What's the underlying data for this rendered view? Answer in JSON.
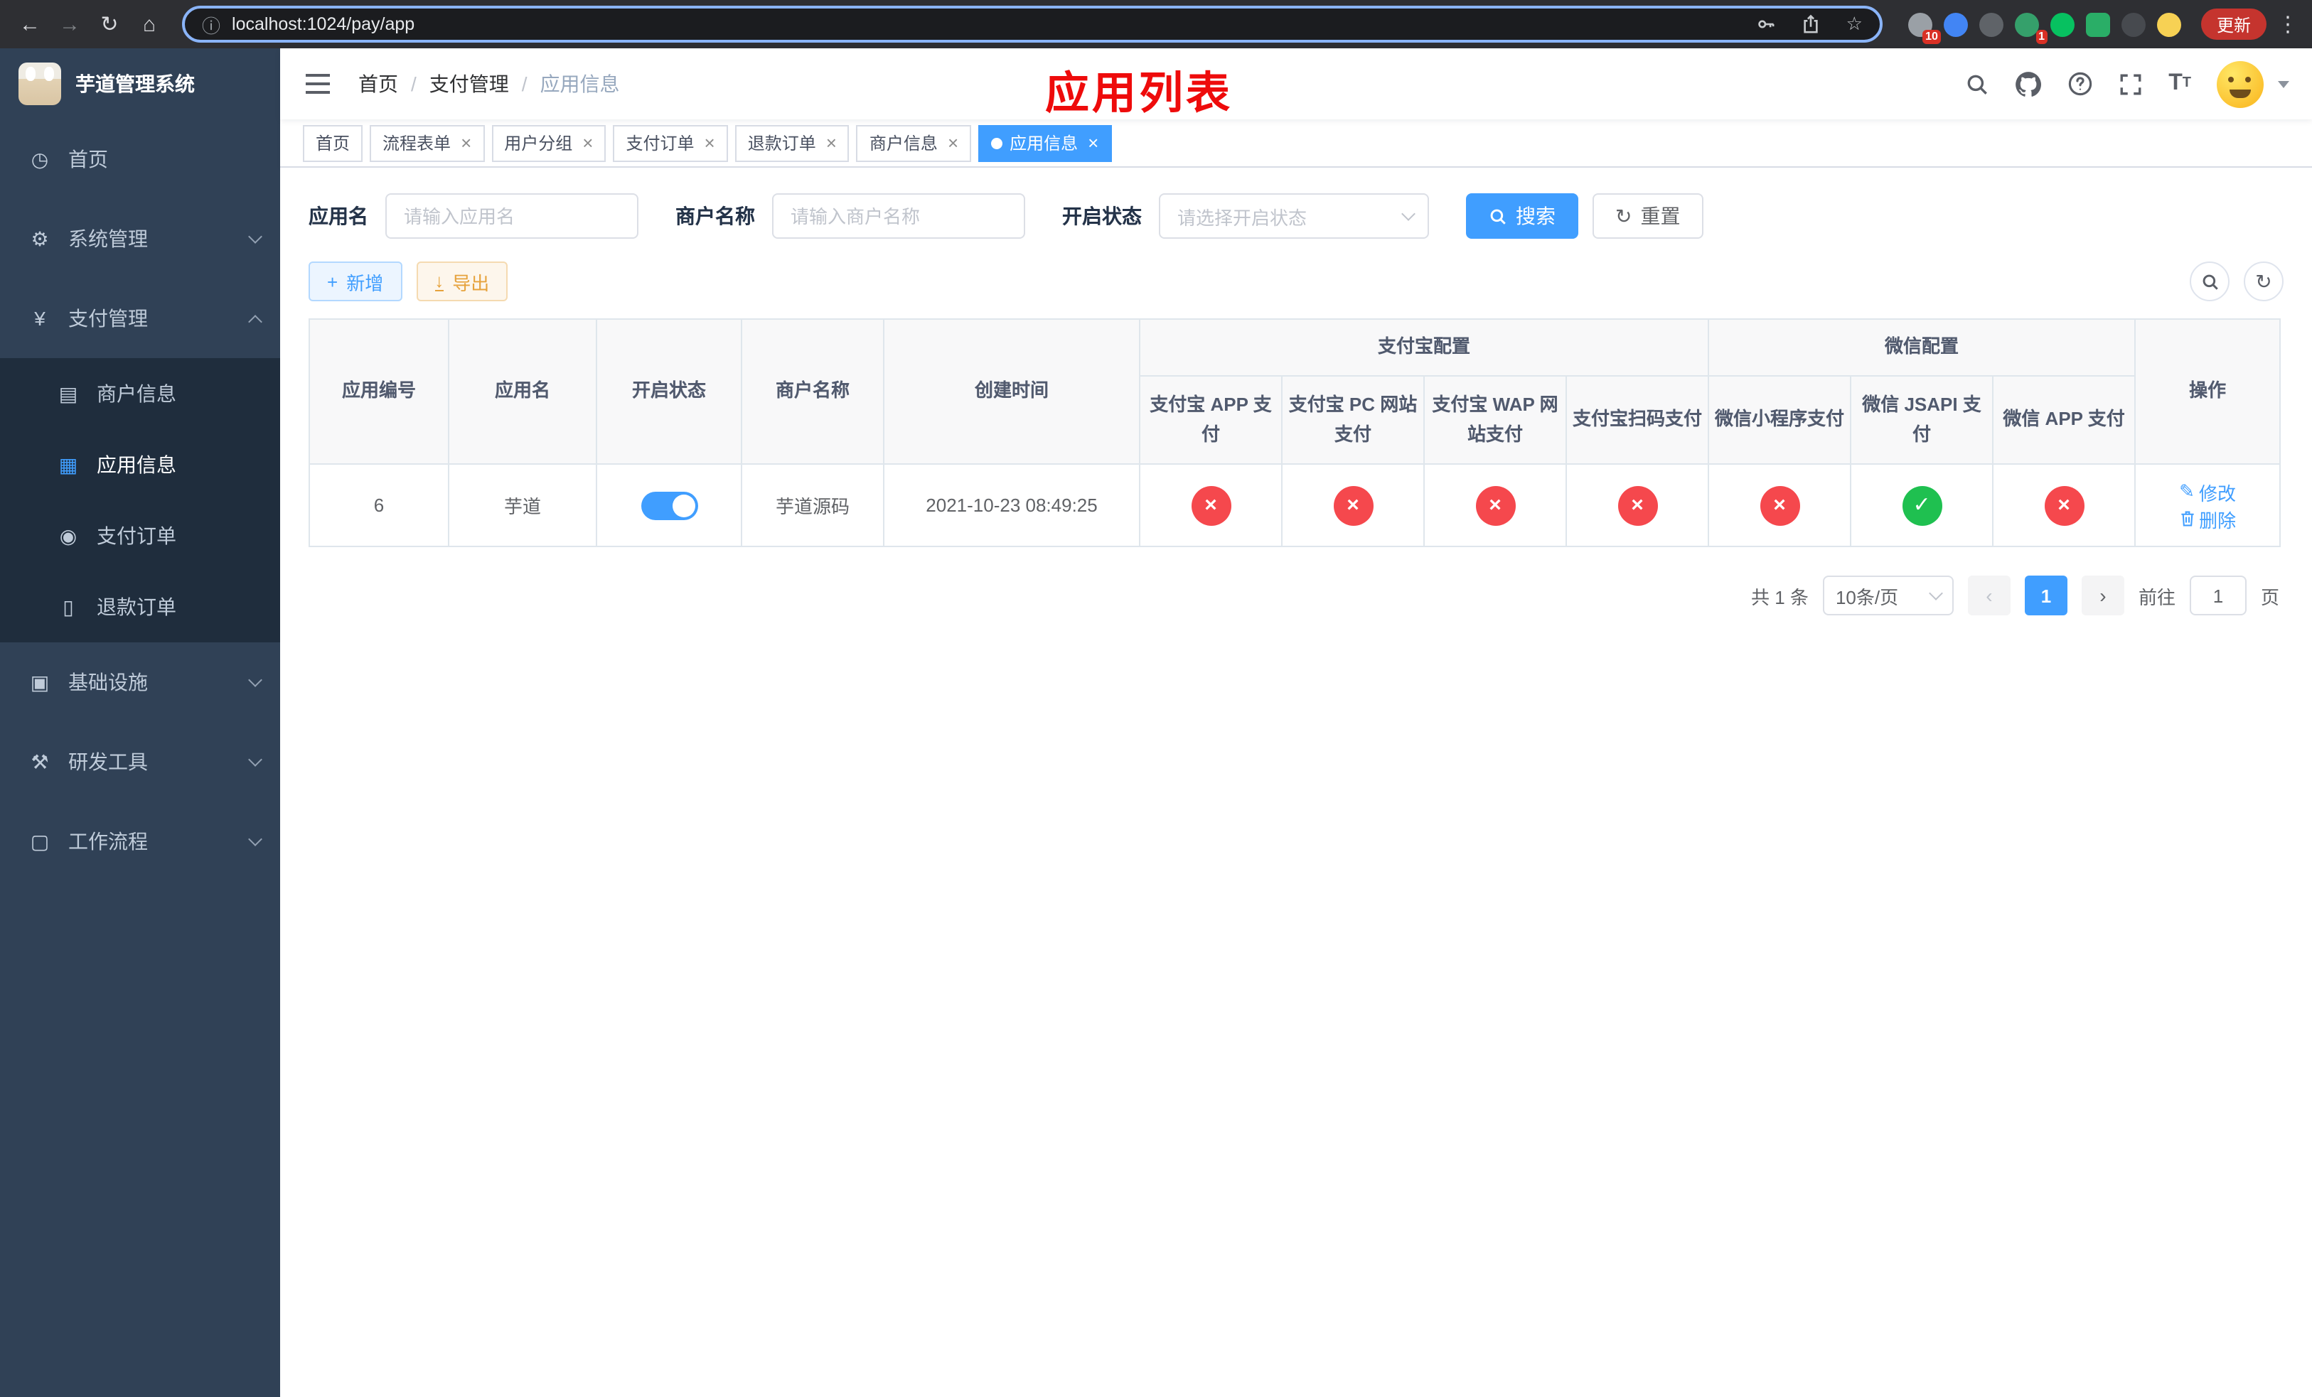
{
  "browser": {
    "url": "localhost:1024/pay/app",
    "update_label": "更新",
    "ext_badge_count": "10",
    "avatar_badge_count": "1"
  },
  "sidebar": {
    "title": "芋道管理系统",
    "items": [
      {
        "label": "首页"
      },
      {
        "label": "系统管理"
      },
      {
        "label": "支付管理"
      },
      {
        "label": "基础设施"
      },
      {
        "label": "研发工具"
      },
      {
        "label": "工作流程"
      }
    ],
    "submenu": [
      {
        "label": "商户信息"
      },
      {
        "label": "应用信息"
      },
      {
        "label": "支付订单"
      },
      {
        "label": "退款订单"
      }
    ]
  },
  "navbar": {
    "breadcrumb": [
      "首页",
      "支付管理",
      "应用信息"
    ],
    "annotation": "应用列表"
  },
  "tabs": [
    {
      "label": "首页"
    },
    {
      "label": "流程表单"
    },
    {
      "label": "用户分组"
    },
    {
      "label": "支付订单"
    },
    {
      "label": "退款订单"
    },
    {
      "label": "商户信息"
    },
    {
      "label": "应用信息"
    }
  ],
  "filters": {
    "app_name_label": "应用名",
    "app_name_placeholder": "请输入应用名",
    "merchant_name_label": "商户名称",
    "merchant_name_placeholder": "请输入商户名称",
    "status_label": "开启状态",
    "status_placeholder": "请选择开启状态",
    "search_button": "搜索",
    "reset_button": "重置"
  },
  "toolbar": {
    "add_button": "新增",
    "export_button": "导出"
  },
  "table": {
    "group_alipay": "支付宝配置",
    "group_wechat": "微信配置",
    "col_app_id": "应用编号",
    "col_app_name": "应用名",
    "col_status": "开启状态",
    "col_merchant": "商户名称",
    "col_created": "创建时间",
    "col_actions": "操作",
    "sub_cols": [
      "支付宝 APP 支付",
      "支付宝 PC 网站支付",
      "支付宝 WAP 网站支付",
      "支付宝扫码支付",
      "微信小程序支付",
      "微信 JSAPI 支付",
      "微信 APP 支付"
    ],
    "row": {
      "app_id": "6",
      "app_name": "芋道",
      "status_enabled": true,
      "merchant": "芋道源码",
      "created": "2021-10-23 08:49:25",
      "configs": [
        "closed",
        "closed",
        "closed",
        "closed",
        "closed",
        "enabled",
        "closed"
      ],
      "edit_label": "修改",
      "delete_label": "删除"
    }
  },
  "pagination": {
    "total": "共 1 条",
    "page_size": "10条/页",
    "page": "1",
    "goto_prefix": "前往",
    "goto_value": "1",
    "goto_suffix": "页"
  },
  "colors": {
    "primary": "#409eff",
    "danger_circle": "#f5484d",
    "success_circle": "#1fc050",
    "annotation": "#ee0b0b"
  }
}
